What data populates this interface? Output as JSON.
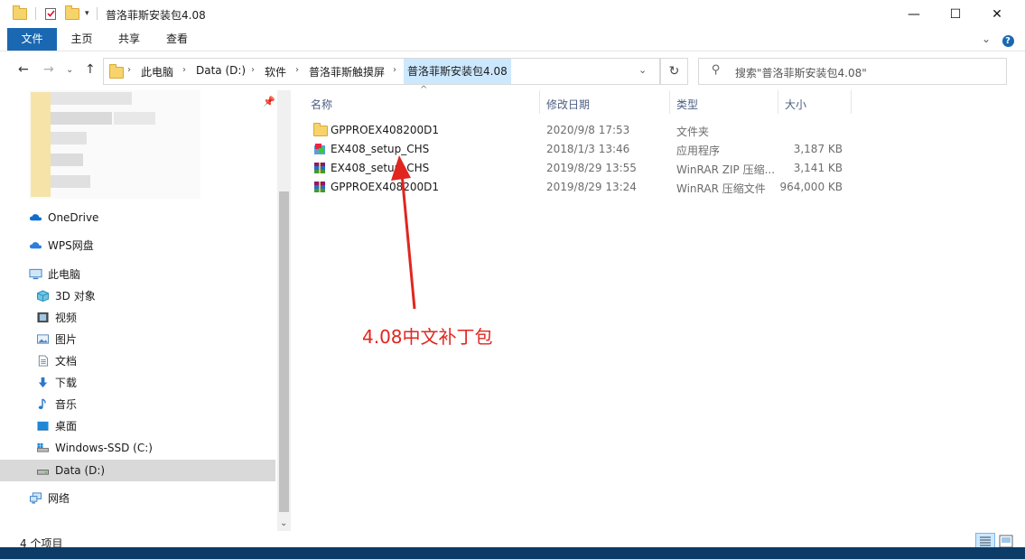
{
  "window": {
    "title": "普洛菲斯安装包4.08",
    "minimize_glyph": "—",
    "maximize_glyph": "☐",
    "close_glyph": "✕"
  },
  "ribbon": {
    "tabs": [
      "文件",
      "主页",
      "共享",
      "查看"
    ],
    "expand_glyph": "⌄",
    "help_glyph": "?"
  },
  "address": {
    "back_glyph": "←",
    "forward_glyph": "→",
    "recent_glyph": "⌄",
    "up_glyph": "↑",
    "breadcrumbs": [
      "此电脑",
      "Data (D:)",
      "软件",
      "普洛菲斯触摸屏",
      "普洛菲斯安装包4.08"
    ],
    "separator": "›",
    "dropdown_glyph": "⌄",
    "refresh_glyph": "↻",
    "search_placeholder": "搜索\"普洛菲斯安装包4.08\""
  },
  "nav": {
    "pin_glyph": "📌",
    "items": [
      {
        "label": "OneDrive",
        "icon": "cloud-icon"
      },
      {
        "label": "WPS网盘",
        "icon": "wps-cloud-icon"
      },
      {
        "label": "此电脑",
        "icon": "computer-icon"
      },
      {
        "label": "3D 对象",
        "icon": "cube-icon"
      },
      {
        "label": "视频",
        "icon": "video-icon"
      },
      {
        "label": "图片",
        "icon": "picture-icon"
      },
      {
        "label": "文档",
        "icon": "document-icon"
      },
      {
        "label": "下载",
        "icon": "download-icon"
      },
      {
        "label": "音乐",
        "icon": "music-icon"
      },
      {
        "label": "桌面",
        "icon": "desktop-icon"
      },
      {
        "label": "Windows-SSD (C:)",
        "icon": "drive-icon"
      },
      {
        "label": "Data (D:)",
        "icon": "drive-icon"
      },
      {
        "label": "网络",
        "icon": "network-icon"
      }
    ],
    "scroll_down_glyph": "⌄"
  },
  "columns": {
    "name": "名称",
    "date": "修改日期",
    "type": "类型",
    "size": "大小",
    "sort_glyph": "^"
  },
  "files": [
    {
      "name": "GPPROEX408200D1",
      "date": "2020/9/8 17:53",
      "type": "文件夹",
      "size": "",
      "icon": "folder-icon"
    },
    {
      "name": "EX408_setup_CHS",
      "date": "2018/1/3 13:46",
      "type": "应用程序",
      "size": "3,187 KB",
      "icon": "installer-icon"
    },
    {
      "name": "EX408_setup_CHS",
      "date": "2019/8/29 13:55",
      "type": "WinRAR ZIP 压缩...",
      "size": "3,141 KB",
      "icon": "winrar-icon"
    },
    {
      "name": "GPPROEX408200D1",
      "date": "2019/8/29 13:24",
      "type": "WinRAR 压缩文件",
      "size": "964,000 KB",
      "icon": "winrar-icon"
    }
  ],
  "annotation": "4.08中文补丁包",
  "status": {
    "count": "4 个项目"
  },
  "colors": {
    "file_tab": "#1a68b2",
    "selected_bg": "#d9d9d9",
    "annotation": "#e0261f"
  }
}
